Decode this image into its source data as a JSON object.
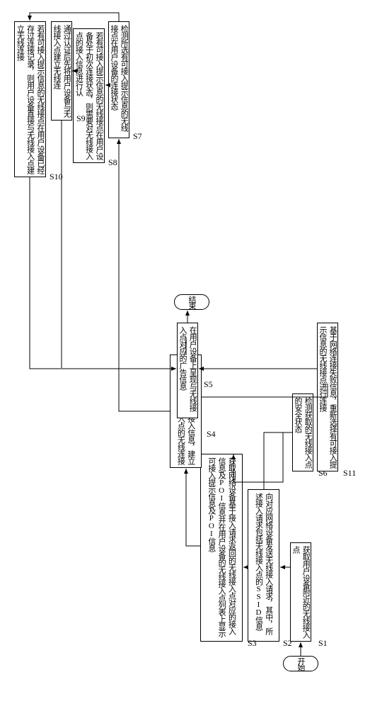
{
  "chart_data": {
    "type": "flowchart",
    "title": "",
    "nodes": [
      {
        "id": "start",
        "type": "terminal",
        "label": "开始"
      },
      {
        "id": "end",
        "type": "terminal",
        "label": "结束"
      },
      {
        "id": "s1",
        "type": "process",
        "label": "获取用户设备附近的无线接入点",
        "step": "S1"
      },
      {
        "id": "s2",
        "type": "process",
        "label": "向对应网络设备发送无线接入请求，其中，所述接入请求包括无线接入点的SSID信息",
        "step": "S2"
      },
      {
        "id": "s3",
        "type": "process",
        "label": "获取网络设备基于接入请求返回的无线接入点对应的接入信息及POI信息并在用户设备的无线接入点列表上显示可接入提示信息及POI信息",
        "step": "S3"
      },
      {
        "id": "s4",
        "type": "process",
        "label": "基于无线接入点的接入信息，建立用户设备与无线接入点的无线连接",
        "step": "S4"
      },
      {
        "id": "s5",
        "type": "process",
        "label": "在用户设备上呈现与无线接入点对应的广告信息",
        "step": "S5"
      },
      {
        "id": "s6",
        "type": "process",
        "label": "检测获取的无线接入点的安全状态",
        "step": "S6"
      },
      {
        "id": "s7",
        "type": "process",
        "label": "检测所选有可接入提示信息的无线接点在用户设备的连接状态",
        "step": "S7"
      },
      {
        "id": "s8",
        "type": "process",
        "label": "若有可接入提示信息的无线接点在用户设备处于初次连接状态，则需要对无线接入点的接入信息进行认",
        "step": "S8"
      },
      {
        "id": "s9",
        "type": "process",
        "label": "通过认证后先将用户设备与无线接入点建立无线连",
        "step": "S9"
      },
      {
        "id": "s10",
        "type": "process",
        "label": "若有可接入提示信息的无线接点在用户设备已经存过连接记录，则用户设备直接与无线接入点建立无线连接",
        "step": "S10"
      },
      {
        "id": "s11",
        "type": "process",
        "label": "基于网络连接失败信息，重新选择有可接入提示信息的无线接点进行连接",
        "step": "S11"
      }
    ]
  },
  "terminals": {
    "start": "开始",
    "end": "结束"
  },
  "steps": {
    "s1": {
      "text": "获取用户设备附近的无线接入点",
      "label": "S1"
    },
    "s2": {
      "text": "向对应网络设备发送无线接入请求，其中，所述接入请求包括无线接入点的SSID信息",
      "label": "S2"
    },
    "s3": {
      "text": "获取网络设备基于接入请求返回的无线接入点对应的接入信息及POI信息并在用户设备的无线接入点列表上显示可接入提示信息及POI信息",
      "label": "S3"
    },
    "s4": {
      "text": "基于无线接入点的接入信息，建立用户设备与无线接入点的无线连接",
      "label": "S4"
    },
    "s5": {
      "text": "在用户设备上呈现与无线接入点对应的广告信息",
      "label": "S5"
    },
    "s6": {
      "text": "检测获取的无线接入点的安全状态",
      "label": "S6"
    },
    "s7": {
      "text": "检测所选有可接入提示信息的无线接点在用户设备的连接状态",
      "label": "S7"
    },
    "s8": {
      "text": "若有可接入提示信息的无线接点在用户设备处于初次连接状态，则需要对无线接入点的接入信息进行认",
      "label": "S8"
    },
    "s9": {
      "text": "通过认证后先将用户设备与无线接入点建立无线连",
      "label": "S9"
    },
    "s10": {
      "text": "若有可接入提示信息的无线接点在用户设备已经存过连接记录，则用户设备直接与无线接入点建立无线连接",
      "label": "S10"
    },
    "s11": {
      "text": "基于网络连接失败信息，重新选择有可接入提示信息的无线接点进行连接",
      "label": "S11"
    }
  }
}
